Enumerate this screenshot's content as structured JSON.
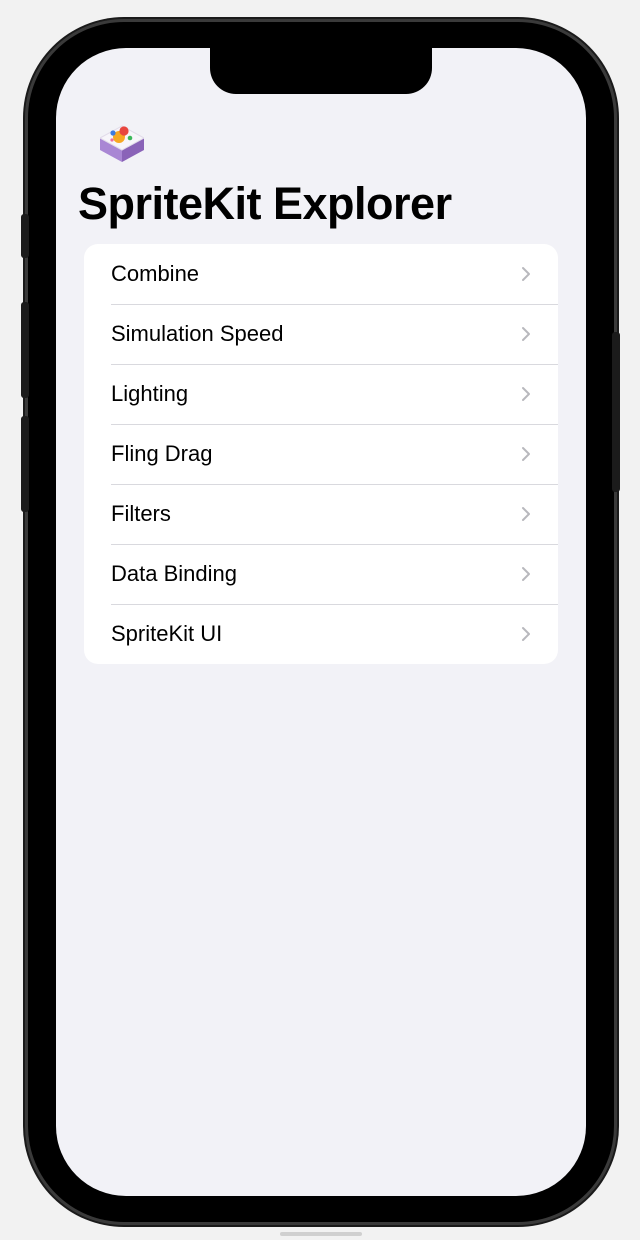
{
  "app": {
    "title": "SpriteKit Explorer",
    "icon": "spritekit-app-icon"
  },
  "menu": {
    "items": [
      {
        "label": "Combine",
        "icon": "chevron-right-icon"
      },
      {
        "label": "Simulation Speed",
        "icon": "chevron-right-icon"
      },
      {
        "label": "Lighting",
        "icon": "chevron-right-icon"
      },
      {
        "label": "Fling Drag",
        "icon": "chevron-right-icon"
      },
      {
        "label": "Filters",
        "icon": "chevron-right-icon"
      },
      {
        "label": "Data Binding",
        "icon": "chevron-right-icon"
      },
      {
        "label": "SpriteKit UI",
        "icon": "chevron-right-icon"
      }
    ]
  },
  "colors": {
    "screen_background": "#f2f2f7",
    "card_background": "#ffffff",
    "separator": "#d9d9de",
    "chevron": "#b8b8bd"
  }
}
